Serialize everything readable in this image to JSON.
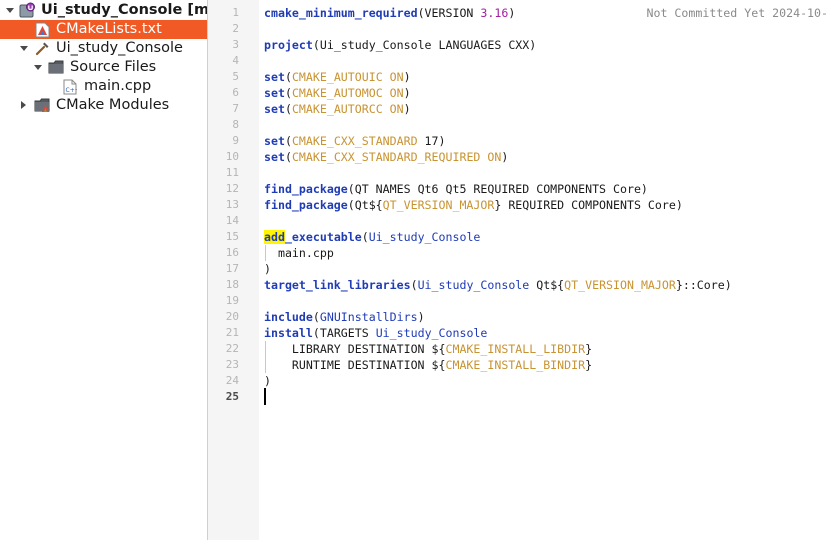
{
  "tree": {
    "project_root": "Ui_study_Console [mas",
    "cmakelists": "CMakeLists.txt",
    "target": "Ui_study_Console",
    "source_files": "Source Files",
    "main_cpp": "main.cpp",
    "cmake_modules": "CMake Modules"
  },
  "editor": {
    "blame": "Not Committed Yet 2024-10-",
    "current_line": 25,
    "line_numbers": [
      "1",
      "2",
      "3",
      "4",
      "5",
      "6",
      "7",
      "8",
      "9",
      "10",
      "11",
      "12",
      "13",
      "14",
      "15",
      "16",
      "17",
      "18",
      "19",
      "20",
      "21",
      "22",
      "23",
      "24",
      "25"
    ],
    "tokens": {
      "l1_kw": "cmake_minimum_required",
      "l1_a": "(VERSION ",
      "l1_num": "3.16",
      "l1_b": ")",
      "l3_kw": "project",
      "l3_a": "(Ui_study_Console LANGUAGES CXX)",
      "set": "set",
      "paren_open": "(",
      "paren_close": ")",
      "space": " ",
      "on": "ON",
      "l5_var": "CMAKE_AUTOUIC",
      "l6_var": "CMAKE_AUTOMOC",
      "l7_var": "CMAKE_AUTORCC",
      "l9_var": "CMAKE_CXX_STANDARD",
      "l9_num": " 17)",
      "l10_var": "CMAKE_CXX_STANDARD_REQUIRED",
      "find_package": "find_package",
      "l12_a": "(QT NAMES Qt6 Qt5 REQUIRED COMPONENTS Core)",
      "l13_a": "(Qt${",
      "qt_version_major": "QT_VERSION_MAJOR",
      "l13_b": "} REQUIRED COMPONENTS Core)",
      "l15_hl": "add",
      "l15_kw": "_executable",
      "l15_a": "(",
      "l15_arg": "Ui_study_Console",
      "l16": "  main.cpp",
      "l18_kw": "target_link_libraries",
      "l18_a": "(",
      "l18_arg": "Ui_study_Console",
      "l18_b": " Qt${",
      "l18_c": "}::Core)",
      "l20_kw": "include",
      "l20_a": "(",
      "l20_arg": "GNUInstallDirs",
      "l21_kw": "install",
      "l21_a": "(TARGETS ",
      "l21_arg": "Ui_study_Console",
      "l22_a": "    LIBRARY DESTINATION ${",
      "l22_var": "CMAKE_INSTALL_LIBDIR",
      "l23_a": "    RUNTIME DESTINATION ${",
      "l23_var": "CMAKE_INSTALL_BINDIR",
      "close_brace": "}"
    }
  },
  "colors": {
    "selection": "#f15a24",
    "keyword": "#1f3cb5",
    "variable": "#c89332",
    "number": "#a020a0",
    "highlight": "#fff500"
  }
}
